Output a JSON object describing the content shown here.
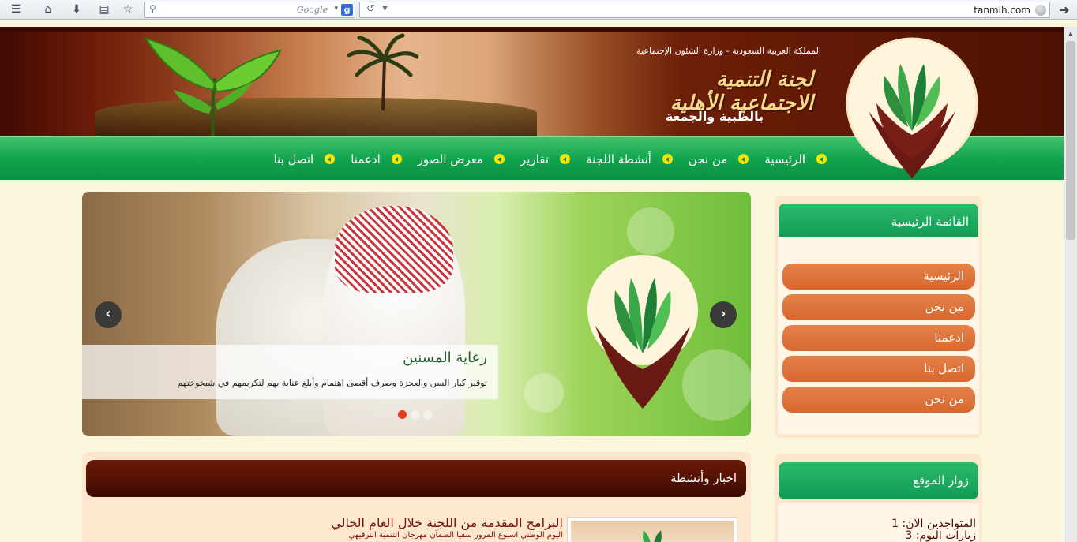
{
  "browser": {
    "search_placeholder": "Google",
    "search_engine_badge": "g",
    "url": "tanmih.com"
  },
  "header": {
    "ministry": "المملكة العربية السعودية - وزارة الشئون الإجتماعية",
    "calligraphy": "لجنة التنمية الاجتماعية الأهلية",
    "subtitle": "بالظبية والجمعة"
  },
  "nav": {
    "items": [
      {
        "label": "الرئيسية"
      },
      {
        "label": "من نحن"
      },
      {
        "label": "أنشطة اللجنة"
      },
      {
        "label": "تقارير"
      },
      {
        "label": "معرض الصور"
      },
      {
        "label": "ادعمنا"
      },
      {
        "label": "اتصل بنا"
      }
    ]
  },
  "slider": {
    "caption_title": "رعاية المسنين",
    "caption_text": "توقير كبار السن والعجزة وصرف أقصى اهتمام وأبلغ عناية بهم لتكريمهم في شيخوختهم",
    "prev_glyph": "‹",
    "next_glyph": "›",
    "dots": [
      true,
      false,
      false
    ],
    "active_slide": 1,
    "slide_count": 3
  },
  "sidebar": {
    "title": "القائمة الرئيسية",
    "items": [
      {
        "label": "الرئيسية"
      },
      {
        "label": "من نحن"
      },
      {
        "label": "ادعمنا"
      },
      {
        "label": "اتصل بنا"
      },
      {
        "label": "من نحن"
      }
    ]
  },
  "visitors": {
    "title": "زوار الموقع",
    "online": "المتواجدين الآن: 1",
    "today": "زيارات اليوم: 3"
  },
  "news": {
    "title": "اخبار وأنشطة",
    "item_title": "البرامج المقدمة من اللجنة خلال العام الحالي",
    "item_sub": "اليوم الوطني اسبوع المرور سقيا الضمآن مهرجان التنمية الترفيهي"
  },
  "colors": {
    "page_bg": "#fbf7dc",
    "nav_green": "#10a24d",
    "menu_orange": "#e07a41",
    "header_brown": "#4d1103",
    "slider_dot_active": "#e33b1d"
  }
}
